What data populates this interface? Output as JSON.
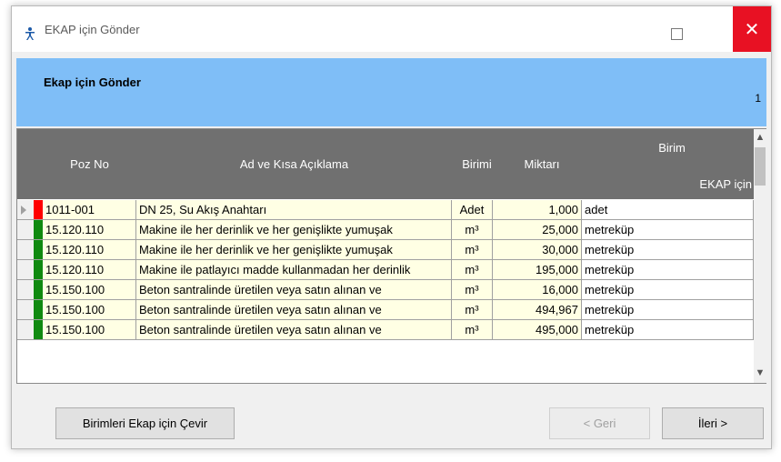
{
  "window": {
    "title": "EKAP için Gönder",
    "close_label": "✕"
  },
  "header": {
    "title": "Ekap için Gönder",
    "page_number": "1"
  },
  "grid": {
    "columns": {
      "poz": "Poz No",
      "ad": "Ad ve Kısa Açıklama",
      "birimi": "Birimi",
      "miktar": "Miktarı",
      "birim_top": "Birim",
      "birim_bottom": "EKAP için"
    },
    "rows": [
      {
        "poz": "1011-001",
        "ad": "DN 25, Su Akış Anahtarı",
        "birimi": "Adet",
        "miktar": "1,000",
        "ekap": "adet",
        "status_color": "#ff0000"
      },
      {
        "poz": "15.120.110",
        "ad": "Makine ile her derinlik ve her genişlikte yumuşak",
        "birimi": "m³",
        "miktar": "25,000",
        "ekap": "metreküp",
        "status_color": "#108a10"
      },
      {
        "poz": "15.120.110",
        "ad": "Makine ile her derinlik ve her genişlikte yumuşak",
        "birimi": "m³",
        "miktar": "30,000",
        "ekap": "metreküp",
        "status_color": "#108a10"
      },
      {
        "poz": "15.120.110",
        "ad": "Makine ile patlayıcı madde kullanmadan her derinlik",
        "birimi": "m³",
        "miktar": "195,000",
        "ekap": "metreküp",
        "status_color": "#108a10"
      },
      {
        "poz": "15.150.100",
        "ad": "Beton santralinde üretilen veya satın alınan ve",
        "birimi": "m³",
        "miktar": "16,000",
        "ekap": "metreküp",
        "status_color": "#108a10"
      },
      {
        "poz": "15.150.100",
        "ad": "Beton santralinde üretilen veya satın alınan ve",
        "birimi": "m³",
        "miktar": "494,967",
        "ekap": "metreküp",
        "status_color": "#108a10"
      },
      {
        "poz": "15.150.100",
        "ad": "Beton santralinde üretilen veya satın alınan ve",
        "birimi": "m³",
        "miktar": "495,000",
        "ekap": "metreküp",
        "status_color": "#108a10"
      }
    ]
  },
  "buttons": {
    "convert": "Birimleri Ekap için Çevir",
    "back": "< Geri",
    "next": "İleri >"
  },
  "icons": {
    "app": "accessibility-person-icon",
    "maximize": "maximize-icon",
    "close": "close-icon",
    "row_indicator": "current-row-triangle-icon"
  }
}
